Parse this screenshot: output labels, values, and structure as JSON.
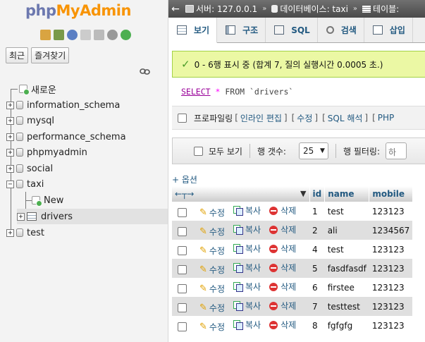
{
  "logo": {
    "php": "php",
    "myadmin": "MyAdmin"
  },
  "nav_buttons": {
    "recent": "최근",
    "favorites": "즐겨찾기"
  },
  "tree": {
    "new": "새로운",
    "databases": [
      "information_schema",
      "mysql",
      "performance_schema",
      "phpmyadmin",
      "social",
      "taxi",
      "test"
    ],
    "taxi_children": {
      "new": "New",
      "table": "drivers"
    }
  },
  "breadcrumb": {
    "server": "서버: 127.0.0.1",
    "database": "데이터베이스: taxi",
    "table": "테이블:"
  },
  "tabs": [
    "보기",
    "구조",
    "SQL",
    "검색",
    "삽입"
  ],
  "success_message": "0 - 6행 표시 중 (합계 7, 질의 실행시간 0.0005 초.)",
  "query": {
    "select": "SELECT",
    "star": "*",
    "from": "FROM",
    "table": "`drivers`"
  },
  "profiling": {
    "label": "프로파일링",
    "links": [
      "인라인 편집",
      "수정",
      "SQL 해석",
      "PHP"
    ]
  },
  "navbar": {
    "show_all": "모두 보기",
    "rows_label": "행 갯수:",
    "rows_value": "25",
    "filter_label": "행 필터링:",
    "filter_placeholder": "하"
  },
  "options_link": "+ 옵션",
  "columns": [
    "id",
    "name",
    "mobile"
  ],
  "actions": {
    "edit": "수정",
    "copy": "복사",
    "delete": "삭제"
  },
  "rows": [
    {
      "id": "1",
      "name": "test",
      "mobile": "123123"
    },
    {
      "id": "2",
      "name": "ali",
      "mobile": "1234567"
    },
    {
      "id": "4",
      "name": "test",
      "mobile": "123123"
    },
    {
      "id": "5",
      "name": "fasdfasdf",
      "mobile": "123123"
    },
    {
      "id": "6",
      "name": "firstee",
      "mobile": "123123"
    },
    {
      "id": "7",
      "name": "testtest",
      "mobile": "123123"
    },
    {
      "id": "8",
      "name": "fgfgfg",
      "mobile": "123123"
    }
  ],
  "colors": {
    "link": "#235a81",
    "success_bg": "#ebf8a4",
    "logo_php": "#6c78af",
    "logo_myadmin": "#f89406"
  }
}
